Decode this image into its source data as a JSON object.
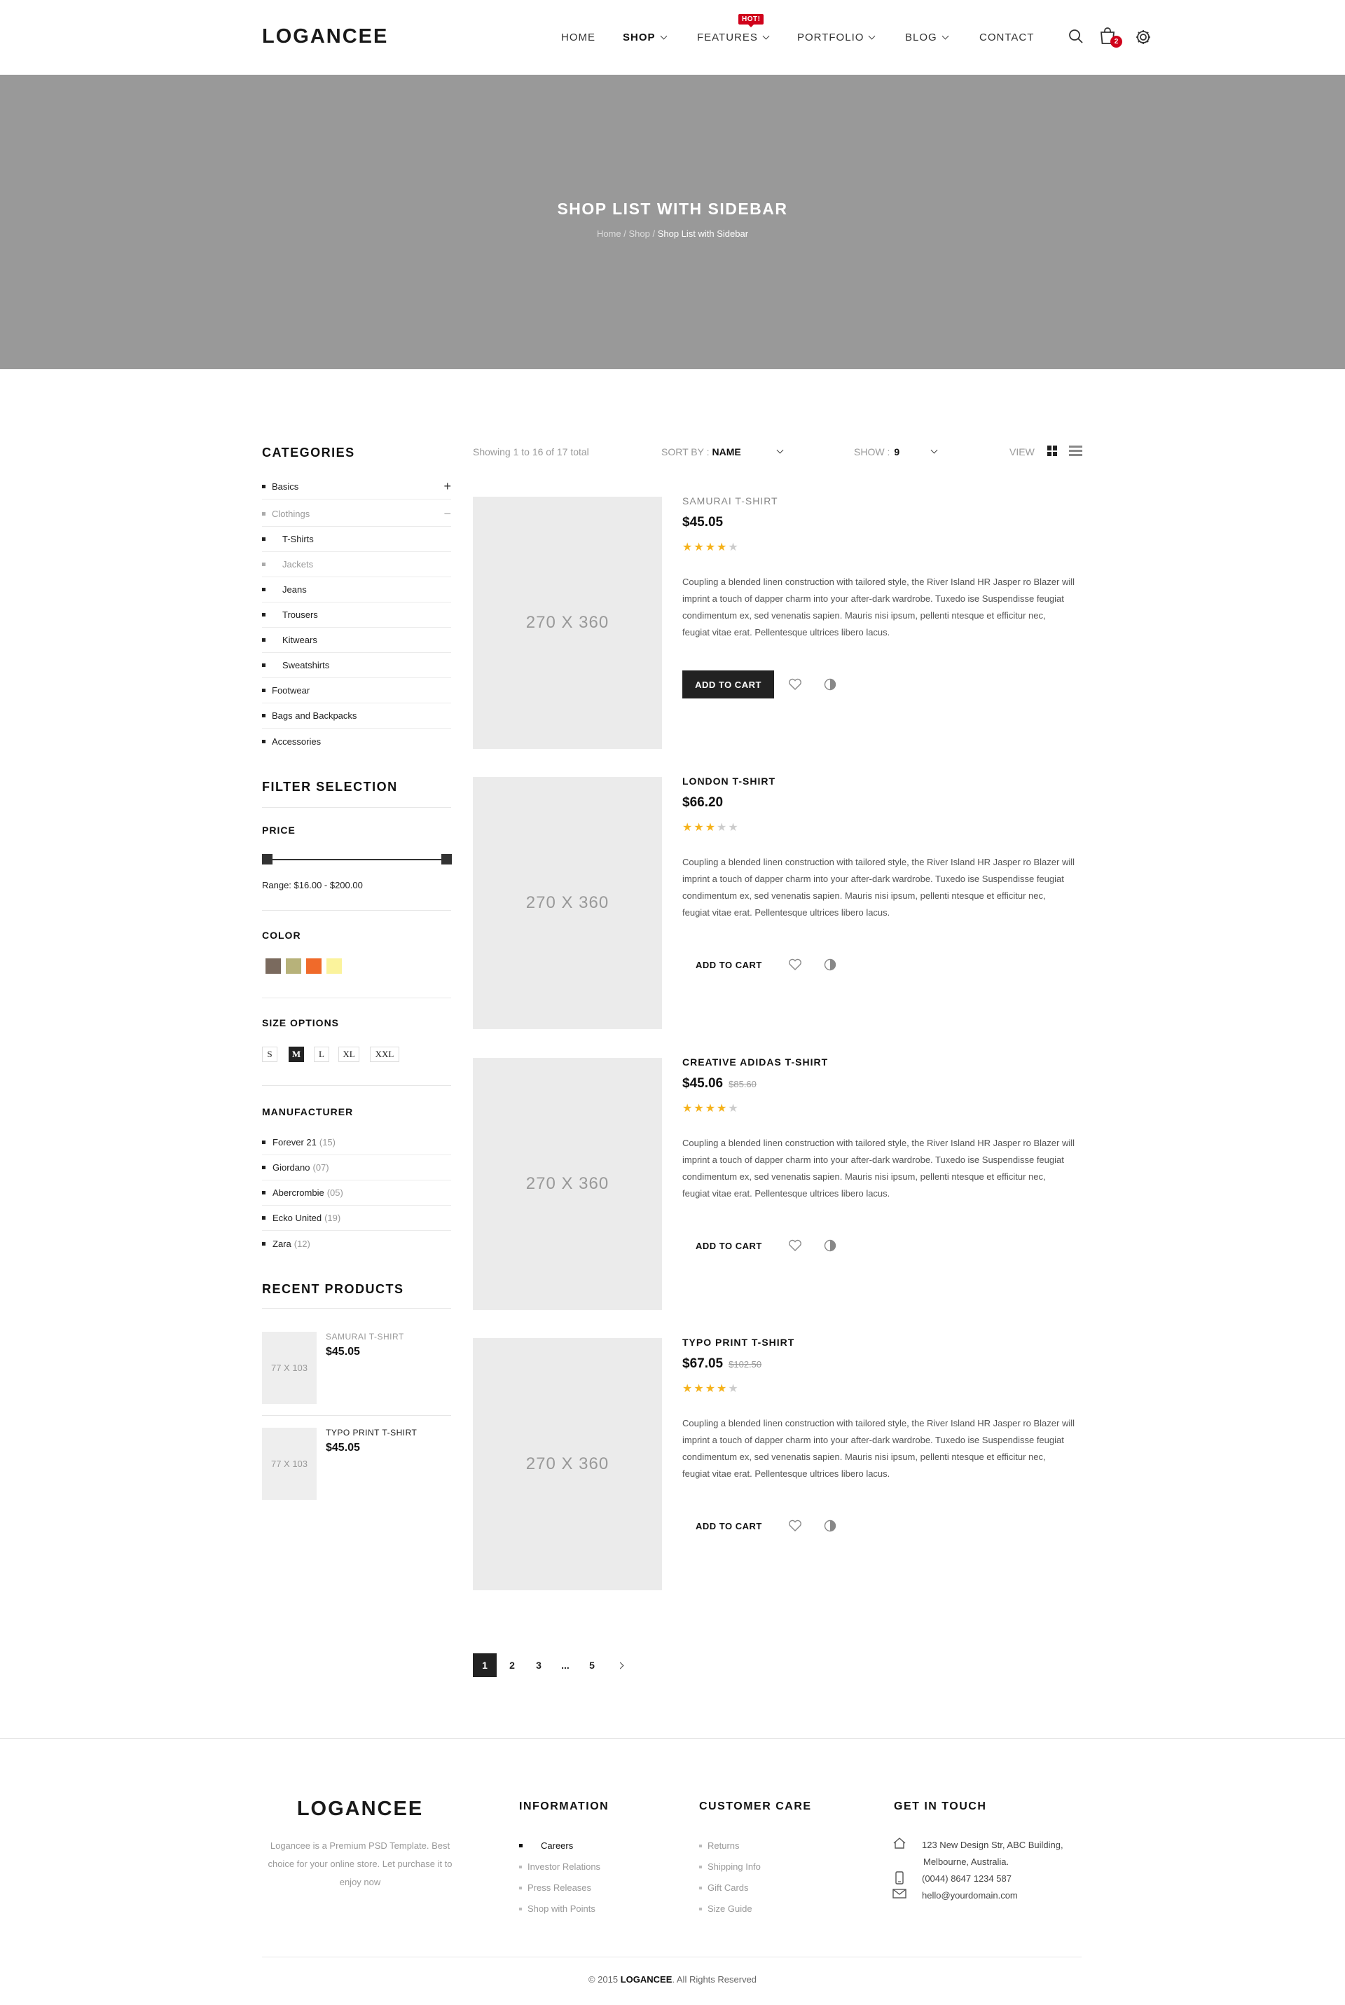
{
  "header": {
    "logo": "LOGANCEE",
    "nav": [
      "HOME",
      "SHOP",
      "FEATURES",
      "PORTFOLIO",
      "BLOG",
      "CONTACT"
    ],
    "hot_badge": "HOT!",
    "cart_count": "2"
  },
  "hero": {
    "title": "SHOP LIST WITH SIDEBAR",
    "crumb_home": "Home",
    "crumb_shop": "Shop",
    "crumb_current": "Shop List with Sidebar"
  },
  "sidebar": {
    "categories_title": "CATEGORIES",
    "categories": [
      "Basics",
      "Clothings",
      "T-Shirts",
      "Jackets",
      "Jeans",
      "Trousers",
      "Kitwears",
      "Sweatshirts",
      "Footwear",
      "Bags and Backpacks",
      "Accessories"
    ],
    "filter_title": "FILTER SELECTION",
    "price_label": "PRICE",
    "price_range_text": "Range: $16.00  -  $200.00",
    "color_label": "COLOR",
    "colors": [
      "#7a6a5e",
      "#b7b27a",
      "#f06a2a",
      "#fbf39c"
    ],
    "size_label": "SIZE OPTIONS",
    "sizes": [
      "S",
      "M",
      "L",
      "XL",
      "XXL"
    ],
    "selected_size": "M",
    "manufacturer_label": "MANUFACTURER",
    "manufacturers": [
      {
        "name": "Forever 21",
        "count": "(15)"
      },
      {
        "name": "Giordano",
        "count": "(07)"
      },
      {
        "name": "Abercrombie",
        "count": "(05)"
      },
      {
        "name": "Ecko United",
        "count": "(19)"
      },
      {
        "name": "Zara",
        "count": "(12)"
      }
    ],
    "recent_title": "RECENT PRODUCTS",
    "recent": [
      {
        "thumb": "77 X 103",
        "name": "SAMURAI T-SHIRT",
        "price": "$45.05"
      },
      {
        "thumb": "77 X 103",
        "name": "TYPO PRINT T-SHIRT",
        "price": "$45.05"
      }
    ]
  },
  "toolbar": {
    "showing": "Showing 1 to 16 of 17 total",
    "sort_label": "SORT BY :",
    "sort_value": "NAME",
    "show_label": "SHOW :",
    "show_value": "9",
    "view_label": "VIEW"
  },
  "products": [
    {
      "img": "270 X 360",
      "name": "SAMURAI T-SHIRT",
      "price": "$45.05",
      "old_price": "",
      "rating": 4,
      "desc": "Coupling a blended linen construction with tailored style, the River Island HR Jasper ro Blazer will imprint a touch of dapper charm into your after-dark wardrobe. Tuxedo ise Suspendisse feugiat condimentum ex, sed venenatis sapien. Mauris nisi ipsum, pellenti ntesque et efficitur nec, feugiat vitae erat. Pellentesque ultrices libero lacus.",
      "cart_label": "ADD TO CART"
    },
    {
      "img": "270 X 360",
      "name": "LONDON T-SHIRT",
      "price": "$66.20",
      "old_price": "",
      "rating": 3,
      "desc": "Coupling a blended linen construction with tailored style, the River Island HR Jasper ro Blazer will imprint a touch of dapper charm into your after-dark wardrobe. Tuxedo ise Suspendisse feugiat condimentum ex, sed venenatis sapien. Mauris nisi ipsum, pellenti ntesque et efficitur nec, feugiat vitae erat. Pellentesque ultrices libero lacus.",
      "cart_label": "ADD TO CART"
    },
    {
      "img": "270 X 360",
      "name": "CREATIVE ADIDAS T-SHIRT",
      "price": "$45.06",
      "old_price": "$85.60",
      "rating": 4,
      "desc": "Coupling a blended linen construction with tailored style, the River Island HR Jasper ro Blazer will imprint a touch of dapper charm into your after-dark wardrobe. Tuxedo ise Suspendisse feugiat condimentum ex, sed venenatis sapien. Mauris nisi ipsum, pellenti ntesque et efficitur nec, feugiat vitae erat. Pellentesque ultrices libero lacus.",
      "cart_label": "ADD TO CART"
    },
    {
      "img": "270 X 360",
      "name": "TYPO PRINT T-SHIRT",
      "price": "$67.05",
      "old_price": "$102.50",
      "rating": 4,
      "desc": "Coupling a blended linen construction with tailored style, the River Island HR Jasper ro Blazer will imprint a touch of dapper charm into your after-dark wardrobe. Tuxedo ise Suspendisse feugiat condimentum ex, sed venenatis sapien. Mauris nisi ipsum, pellenti ntesque et efficitur nec, feugiat vitae erat. Pellentesque ultrices libero lacus.",
      "cart_label": "ADD TO CART"
    }
  ],
  "pagination": [
    "1",
    "2",
    "3",
    "...",
    "5"
  ],
  "footer": {
    "logo": "LOGANCEE",
    "about": "Logancee is a Premium PSD Template. Best choice for your online store. Let purchase it to enjoy now",
    "info_title": "INFORMATION",
    "info_links": [
      "Careers",
      "Investor Relations",
      "Press Releases",
      "Shop with Points"
    ],
    "care_title": "CUSTOMER CARE",
    "care_links": [
      "Returns",
      "Shipping Info",
      "Gift Cards",
      "Size Guide"
    ],
    "touch_title": "GET IN TOUCH",
    "address_line1": "123 New Design Str, ABC Building,",
    "address_line2": "Melbourne, Australia.",
    "phone": "(0044) 8647 1234 587",
    "email": "hello@yourdomain.com",
    "copyright_pre": "© 2015",
    "copyright_brand": "LOGANCEE",
    "copyright_post": ". All Rights Reserved"
  }
}
